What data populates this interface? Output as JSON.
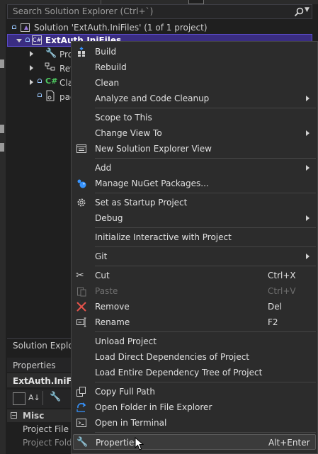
{
  "search": {
    "placeholder": "Search Solution Explorer (Ctrl+`)"
  },
  "tree": {
    "solution_label": "Solution 'ExtAuth.IniFiles' (1 of 1 project)",
    "project_label": "ExtAuth.IniFiles",
    "children": [
      {
        "label": "Pro",
        "icon": "wrench-icon"
      },
      {
        "label": "Ref",
        "icon": "references-icon"
      },
      {
        "label": "Cla",
        "icon": "csharp-file-icon"
      },
      {
        "label": "pac",
        "icon": "package-file-icon"
      }
    ]
  },
  "panels": {
    "solution_explorer_tab": "Solution Explor",
    "properties_title": "Properties",
    "properties_object": "ExtAuth.IniFile",
    "misc_label": "Misc",
    "rows": [
      "Project File",
      "Project Folde"
    ]
  },
  "menu": {
    "items": [
      {
        "label": "Build",
        "icon": "build-icon"
      },
      {
        "label": "Rebuild"
      },
      {
        "label": "Clean"
      },
      {
        "label": "Analyze and Code Cleanup",
        "submenu": true
      },
      {
        "label": "Scope to This"
      },
      {
        "label": "Change View To",
        "submenu": true
      },
      {
        "label": "New Solution Explorer View",
        "icon": "new-view-icon"
      },
      {
        "label": "Add",
        "submenu": true
      },
      {
        "label": "Manage NuGet Packages...",
        "icon": "nuget-icon"
      },
      {
        "label": "Set as Startup Project",
        "icon": "gear-icon"
      },
      {
        "label": "Debug",
        "submenu": true
      },
      {
        "label": "Initialize Interactive with Project"
      },
      {
        "label": "Git",
        "submenu": true
      },
      {
        "label": "Cut",
        "shortcut": "Ctrl+X",
        "icon": "scissors-icon"
      },
      {
        "label": "Paste",
        "shortcut": "Ctrl+V",
        "icon": "paste-icon",
        "disabled": true
      },
      {
        "label": "Remove",
        "shortcut": "Del",
        "icon": "remove-icon"
      },
      {
        "label": "Rename",
        "shortcut": "F2",
        "icon": "rename-icon"
      },
      {
        "label": "Unload Project"
      },
      {
        "label": "Load Direct Dependencies of Project"
      },
      {
        "label": "Load Entire Dependency Tree of Project"
      },
      {
        "label": "Copy Full Path",
        "icon": "copy-icon"
      },
      {
        "label": "Open Folder in File Explorer",
        "icon": "open-folder-icon"
      },
      {
        "label": "Open in Terminal",
        "icon": "terminal-icon"
      },
      {
        "label": "Properties",
        "shortcut": "Alt+Enter",
        "icon": "wrench-icon",
        "highlighted": true
      }
    ]
  },
  "colors": {
    "background": "#1f1f1f",
    "menu_background": "#2c2c2c",
    "selection": "#3a2d82",
    "accent_red": "#e5534b",
    "accent_blue": "#3794ff"
  }
}
